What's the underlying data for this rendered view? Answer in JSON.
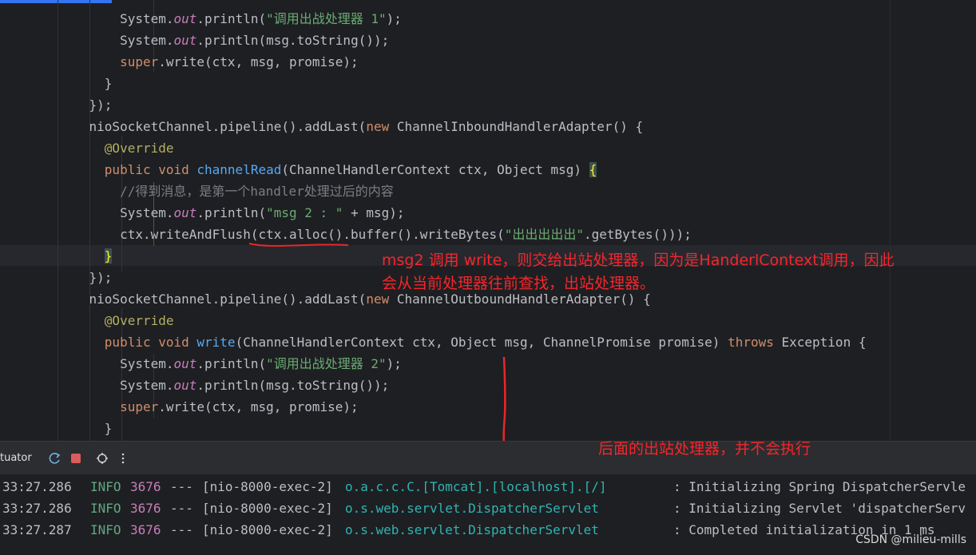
{
  "editor": {
    "lines": [
      {
        "indent": "        ",
        "tokens": [
          [
            "plain",
            "System."
          ],
          [
            "st",
            "out"
          ],
          [
            "plain",
            ".println("
          ],
          [
            "str",
            "\"调用出战处理器 1\""
          ],
          [
            "plain",
            ");"
          ]
        ]
      },
      {
        "indent": "        ",
        "tokens": [
          [
            "plain",
            "System."
          ],
          [
            "st",
            "out"
          ],
          [
            "plain",
            ".println(msg.toString());"
          ]
        ]
      },
      {
        "indent": "        ",
        "tokens": [
          [
            "kw",
            "super"
          ],
          [
            "plain",
            ".write(ctx, msg, promise);"
          ]
        ]
      },
      {
        "indent": "      ",
        "tokens": [
          [
            "plain",
            "}"
          ]
        ]
      },
      {
        "indent": "    ",
        "tokens": [
          [
            "plain",
            "});"
          ]
        ]
      },
      {
        "indent": "    ",
        "tokens": [
          [
            "plain",
            "nioSocketChannel.pipeline().addLast("
          ],
          [
            "kw",
            "new "
          ],
          [
            "plain",
            "ChannelInboundHandlerAdapter() {"
          ]
        ]
      },
      {
        "indent": "      ",
        "tokens": [
          [
            "ann",
            "@Override"
          ]
        ]
      },
      {
        "indent": "      ",
        "tokens": [
          [
            "kw",
            "public void "
          ],
          [
            "fn",
            "channelRead"
          ],
          [
            "plain",
            "(ChannelHandlerContext ctx, Object msg) "
          ],
          [
            "hl",
            "{"
          ]
        ]
      },
      {
        "indent": "        ",
        "tokens": [
          [
            "cmt",
            "//得到消息，是第一个handler处理过后的内容"
          ]
        ]
      },
      {
        "indent": "        ",
        "tokens": [
          [
            "plain",
            "System."
          ],
          [
            "st",
            "out"
          ],
          [
            "plain",
            ".println("
          ],
          [
            "str",
            "\"msg 2 : \""
          ],
          [
            "plain",
            " + msg);"
          ]
        ]
      },
      {
        "indent": "        ",
        "tokens": [
          [
            "plain",
            "ctx.writeAndFlush(ctx.alloc().buffer().writeBytes("
          ],
          [
            "str",
            "\"出出出出出\""
          ],
          [
            "plain",
            ".getBytes()));"
          ]
        ]
      },
      {
        "indent": "      ",
        "tokens": [
          [
            "hl",
            "}"
          ]
        ]
      },
      {
        "indent": "    ",
        "tokens": [
          [
            "plain",
            "});"
          ]
        ]
      },
      {
        "indent": "    ",
        "tokens": [
          [
            "plain",
            "nioSocketChannel.pipeline().addLast("
          ],
          [
            "kw",
            "new "
          ],
          [
            "plain",
            "ChannelOutboundHandlerAdapter() {"
          ]
        ]
      },
      {
        "indent": "      ",
        "tokens": [
          [
            "ann",
            "@Override"
          ]
        ]
      },
      {
        "indent": "      ",
        "tokens": [
          [
            "kw",
            "public void "
          ],
          [
            "fn",
            "write"
          ],
          [
            "plain",
            "(ChannelHandlerContext ctx, Object msg, ChannelPromise promise) "
          ],
          [
            "kw",
            "throws "
          ],
          [
            "plain",
            "Exception {"
          ]
        ]
      },
      {
        "indent": "        ",
        "tokens": [
          [
            "plain",
            "System."
          ],
          [
            "st",
            "out"
          ],
          [
            "plain",
            ".println("
          ],
          [
            "str",
            "\"调用出战处理器 2\""
          ],
          [
            "plain",
            ");"
          ]
        ]
      },
      {
        "indent": "        ",
        "tokens": [
          [
            "plain",
            "System."
          ],
          [
            "st",
            "out"
          ],
          [
            "plain",
            ".println(msg.toString());"
          ]
        ]
      },
      {
        "indent": "        ",
        "tokens": [
          [
            "kw",
            "super"
          ],
          [
            "plain",
            ".write(ctx, msg, promise);"
          ]
        ]
      },
      {
        "indent": "      ",
        "tokens": [
          [
            "plain",
            "}"
          ]
        ]
      }
    ]
  },
  "annotations": {
    "note1_line1": "msg2 调用 write，则交给出站处理器，因为是HanderlContext调用，因此",
    "note1_line2": "会从当前处理器往前查找，出站处理器。",
    "note2": "后面的出站处理器，并不会执行"
  },
  "panel": {
    "title": "tuator",
    "buttons": [
      "rerun-icon",
      "stop-icon",
      "debug-settings-icon",
      "more-options-icon"
    ]
  },
  "console": {
    "logs": [
      {
        "ts": "33:27.286",
        "level": "INFO",
        "pid": "3676",
        "sep": "---",
        "thread": "[nio-8000-exec-2]",
        "logger": "o.a.c.c.C.[Tomcat].[localhost].[/]",
        "msg": ": Initializing Spring DispatcherServle"
      },
      {
        "ts": "33:27.286",
        "level": "INFO",
        "pid": "3676",
        "sep": "---",
        "thread": "[nio-8000-exec-2]",
        "logger": "o.s.web.servlet.DispatcherServlet",
        "msg": ": Initializing Servlet 'dispatcherServ"
      },
      {
        "ts": "33:27.287",
        "level": "INFO",
        "pid": "3676",
        "sep": "---",
        "thread": "[nio-8000-exec-2]",
        "logger": "o.s.web.servlet.DispatcherServlet",
        "msg": ": Completed initialization in 1 ms"
      }
    ]
  },
  "watermark": "CSDN @milieu-mills",
  "colors": {
    "annotation_red": "#f5262b",
    "console_bg": "#1e1f22",
    "toolbar_bg": "#2b2d30"
  }
}
